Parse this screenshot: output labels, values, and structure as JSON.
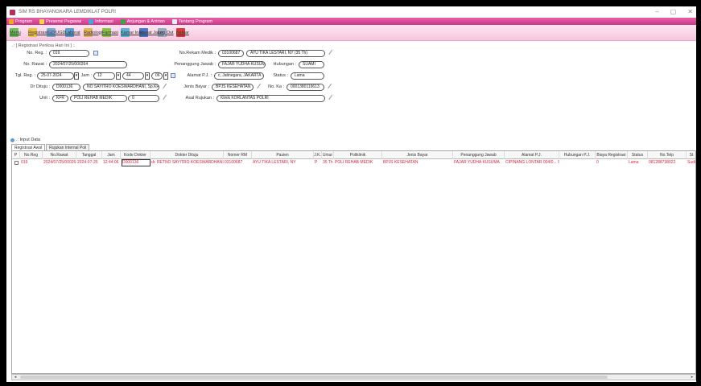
{
  "window": {
    "title": "SIM RS BHAYANGKARA LEMDIKLAT POLRI",
    "controls": [
      "–",
      "▢",
      "✕"
    ]
  },
  "menubar": {
    "items": [
      {
        "label": "Program",
        "icon": "program-icon",
        "color": "#f5a623"
      },
      {
        "label": "Presensi Pegawai",
        "icon": "presensi-icon",
        "color": "#ffd54a"
      },
      {
        "label": "Informasi",
        "icon": "informasi-icon",
        "color": "#4aa3df"
      },
      {
        "label": "Anjungan & Antrian",
        "icon": "anjungan-icon",
        "color": "#43a047"
      },
      {
        "label": "Tentang Program",
        "icon": "tentang-icon",
        "color": "#e8eef7"
      }
    ]
  },
  "toolbar": {
    "items": [
      {
        "label": "Menu",
        "icon": "menu-icon",
        "color": "#6bbf59"
      },
      {
        "label": "Registrasi",
        "icon": "registrasi-icon",
        "color": "#f0c040"
      },
      {
        "label": "IGD/UGD",
        "icon": "igd-icon",
        "color": "#7aa7d8"
      },
      {
        "label": "Laborat",
        "icon": "laborat-icon",
        "color": "#5aa0d0"
      },
      {
        "label": "Radiologi",
        "icon": "radiologi-icon",
        "color": "#e7b45c"
      },
      {
        "label": "Farmasi",
        "icon": "farmasi-icon",
        "color": "#8bc34a"
      },
      {
        "label": "Kamar Inap",
        "icon": "kamar-inap-icon",
        "color": "#5ab0d8"
      },
      {
        "label": "Rawat Jalan",
        "icon": "rawat-jalan-icon",
        "color": "#4a78c8"
      },
      {
        "label": "Log Out",
        "icon": "logout-icon",
        "color": "#9aa8c0"
      },
      {
        "label": "Keluar",
        "icon": "keluar-icon",
        "color": "#d83a3a"
      }
    ]
  },
  "form": {
    "section_title": ".: [ Registrasi Periksa Hari Ini ] :.",
    "no_reg_label": "No. Reg. :",
    "no_reg_value": "019",
    "no_rawat_label": "No. Rawat :",
    "no_rawat_value": "2024/07/25/000264",
    "tgl_reg_label": "Tgl. Reg. :",
    "tgl_reg_value": "25-07-2024",
    "jam_label": "Jam :",
    "jam_h": "12",
    "jam_m": "44",
    "jam_s": "06",
    "dr_label": "Dr Dituju :",
    "dr_code": "D000136",
    "dr_name": "NO SAYITRO KOESWARDHANI, Sp.KFR",
    "unit_label": "Unit :",
    "unit_code": "KFR",
    "unit_name": "POLI REHAB MEDIK",
    "unit_extra": "0",
    "rm_label": "No.Rekam Medik :",
    "rm_value": "03100687",
    "pasien_name": "AYU TIKA LESTARI, NY (35 Th)",
    "pj_label": "Penanggung Jawab :",
    "pj_value": "FAJAR YUDHA KUSUMA",
    "hub_label": "Hubungan :",
    "hub_value": "SUAMI",
    "alamat_label": "Alamat P.J. :",
    "alamat_value": "c, Jatinegara, JAKARTA TIMUR",
    "status_label": "Status :",
    "status_value": "Lama",
    "bayar_label": "Jenis Bayar :",
    "bayar_value": "BPJS KESEHATAN",
    "ka_label": "No. Ka :",
    "ka_value": "0001380119613",
    "rujukan_label": "Asal Rujukan :",
    "rujukan_value": "Klinik KORLANTAS POLRI"
  },
  "input_data_label": ".: Input Data",
  "tabs": [
    "Registrasi Awal",
    "Rujukan Internal Poli"
  ],
  "table": {
    "headers": [
      "P",
      "No.Reg",
      "No.Rawat",
      "Tanggal",
      "Jam",
      "Kode Dokter",
      "Dokter Dituju",
      "Nomer RM",
      "Pasien",
      "J.K.",
      "Umur",
      "Poliklinik",
      "Jenis Bayar",
      "Penanggung Jawab",
      "Alamat P.J.",
      "Hubungan P.J.",
      "Biaya Registrasi",
      "Status",
      "No.Telp",
      "St"
    ],
    "rows": [
      [
        "",
        "019",
        "2024/07/25/000264",
        "2024-07-25",
        "12:44:06",
        "D000136",
        "dr. RETNO SAYITRO KOESWARDHANI, ...",
        "03100687",
        "AYU TIKA LESTARI, NY",
        "P",
        "35 Th",
        "POLI REHAB MEDIK",
        "BPJS KESEHATAN",
        "FAJAR YUDHA KUSUMA",
        "CIPINANG LONTAR 004/0... SUAMI",
        "",
        "0",
        "Lama",
        "081288738022",
        "Sudi"
      ]
    ]
  }
}
